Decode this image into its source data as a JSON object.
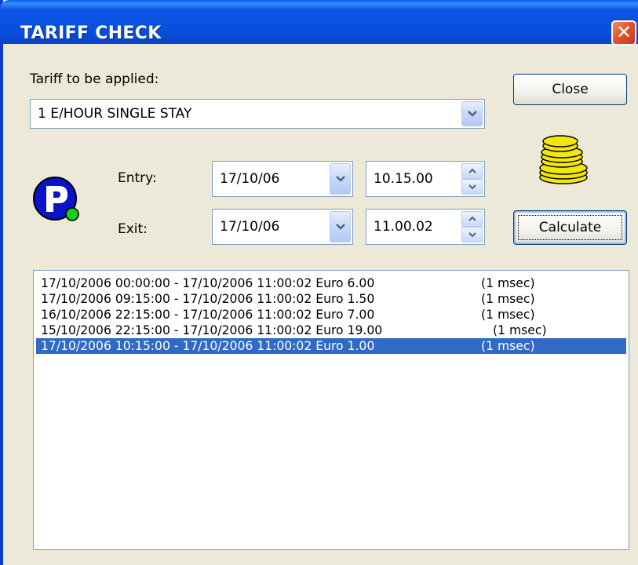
{
  "window": {
    "title": "TARIFF CHECK",
    "close_glyph": "✕"
  },
  "tariff": {
    "label": "Tariff to be applied:",
    "selected": "1 E/HOUR SINGLE STAY"
  },
  "entry": {
    "label": "Entry:",
    "date": "17/10/06",
    "time": "10.15.00"
  },
  "exit": {
    "label": "Exit:",
    "date": "17/10/06",
    "time": "11.00.02"
  },
  "buttons": {
    "close": "Close",
    "calculate": "Calculate"
  },
  "icons": {
    "parking": "parking-p-icon",
    "coins": "coins-stack-icon"
  },
  "colors": {
    "selection": "#316ac5",
    "titlebar": "#0650dc",
    "parking_blue": "#0b12c8",
    "coin": "#f2e60a"
  },
  "results": [
    {
      "text": "17/10/2006 00:00:00 - 17/10/2006 11:00:02 Euro 6.00",
      "time": "(1 msec)",
      "selected": false
    },
    {
      "text": "17/10/2006 09:15:00 - 17/10/2006 11:00:02 Euro 1.50",
      "time": "(1 msec)",
      "selected": false
    },
    {
      "text": "16/10/2006 22:15:00 - 17/10/2006 11:00:02 Euro 7.00",
      "time": "(1 msec)",
      "selected": false
    },
    {
      "text": "15/10/2006 22:15:00 - 17/10/2006 11:00:02 Euro 19.00",
      "time": "(1 msec)",
      "selected": false
    },
    {
      "text": "17/10/2006 10:15:00 - 17/10/2006 11:00:02 Euro 1.00",
      "time": "(1 msec)",
      "selected": true
    }
  ]
}
